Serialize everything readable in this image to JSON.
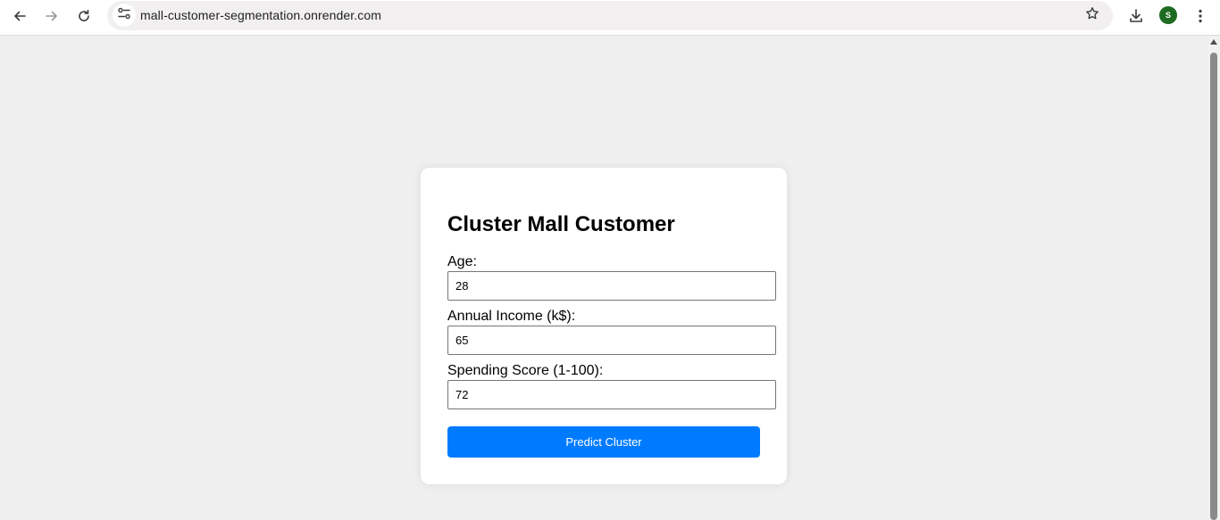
{
  "browser": {
    "url": "mall-customer-segmentation.onrender.com",
    "avatar_letter": "S",
    "avatar_color": "#1e6b22"
  },
  "form": {
    "title": "Cluster Mall Customer",
    "age_label": "Age:",
    "age_value": "28",
    "income_label": "Annual Income (k$):",
    "income_value": "65",
    "spending_label": "Spending Score (1-100):",
    "spending_value": "72",
    "submit_label": "Predict Cluster",
    "button_color": "#007bff"
  },
  "icons": {
    "back": "back-arrow-icon",
    "forward": "forward-arrow-icon",
    "reload": "reload-icon",
    "site_info": "tune-icon",
    "bookmark": "star-icon",
    "download": "download-icon",
    "menu": "kebab-menu-icon"
  }
}
